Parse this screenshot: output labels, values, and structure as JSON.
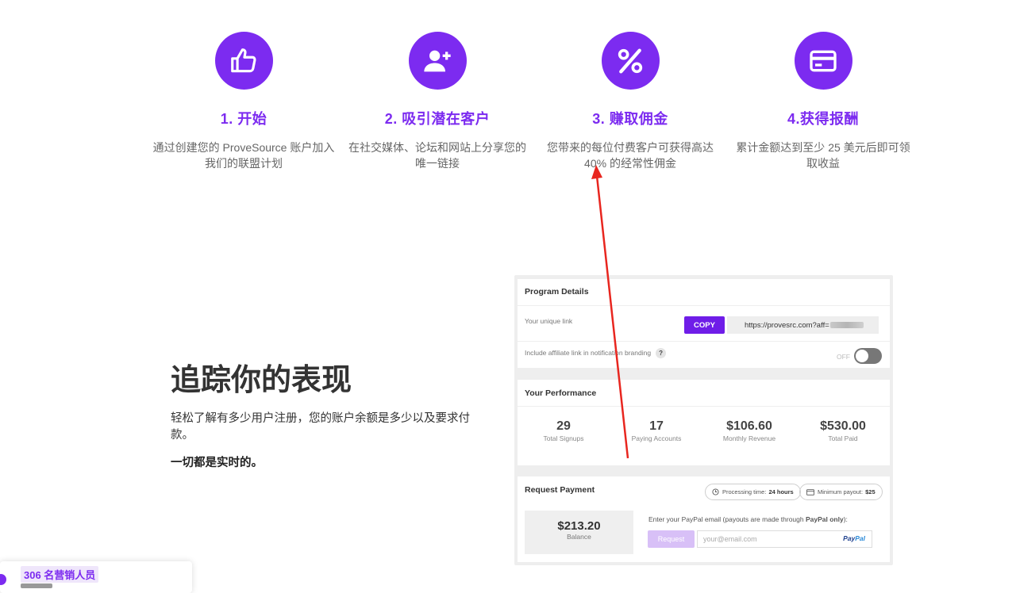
{
  "steps": [
    {
      "title": "1. 开始",
      "desc": "通过创建您的 ProveSource 账户加入我们的联盟计划",
      "icon": "thumbs-up-icon"
    },
    {
      "title": "2. 吸引潜在客户",
      "desc": "在社交媒体、论坛和网站上分享您的唯一链接",
      "icon": "user-plus-icon"
    },
    {
      "title": "3. 赚取佣金",
      "desc": "您带来的每位付费客户可获得高达 40% 的经常性佣金",
      "icon": "percent-icon"
    },
    {
      "title": "4.获得报酬",
      "desc": "累计金额达到至少 25 美元后即可领取收益",
      "icon": "credit-card-icon"
    }
  ],
  "track": {
    "title": "追踪你的表现",
    "desc": "轻松了解有多少用户注册，您的账户余额是多少以及要求付款。",
    "realtime": "一切都是实时的。"
  },
  "program": {
    "heading": "Program Details",
    "link_label": "Your unique link",
    "copy_label": "COPY",
    "link_value": "https://provesrc.com?aff=",
    "branding_label": "Include affiliate link in notification branding",
    "help": "?",
    "toggle_state": "OFF"
  },
  "performance": {
    "heading": "Your Performance",
    "stats": [
      {
        "value": "29",
        "label": "Total Signups"
      },
      {
        "value": "17",
        "label": "Paying Accounts"
      },
      {
        "value": "$106.60",
        "label": "Monthly Revenue"
      },
      {
        "value": "$530.00",
        "label": "Total Paid"
      }
    ]
  },
  "payment": {
    "heading": "Request Payment",
    "processing_label": "Processing time:",
    "processing_value": "24 hours",
    "minimum_label": "Minimum payout:",
    "minimum_value": "$25",
    "balance_value": "$213.20",
    "balance_label": "Balance",
    "paypal_prompt_pre": "Enter your PayPal email (payouts are made through ",
    "paypal_prompt_bold": "PayPal only",
    "paypal_prompt_post": "):",
    "request_label": "Request",
    "email_placeholder": "your@email.com",
    "paypal_logo_1": "Pay",
    "paypal_logo_2": "Pal"
  },
  "widget": {
    "count": "306 名营销人员"
  },
  "colors": {
    "accent": "#7c2bf0",
    "annotation_arrow": "#e8261f"
  }
}
